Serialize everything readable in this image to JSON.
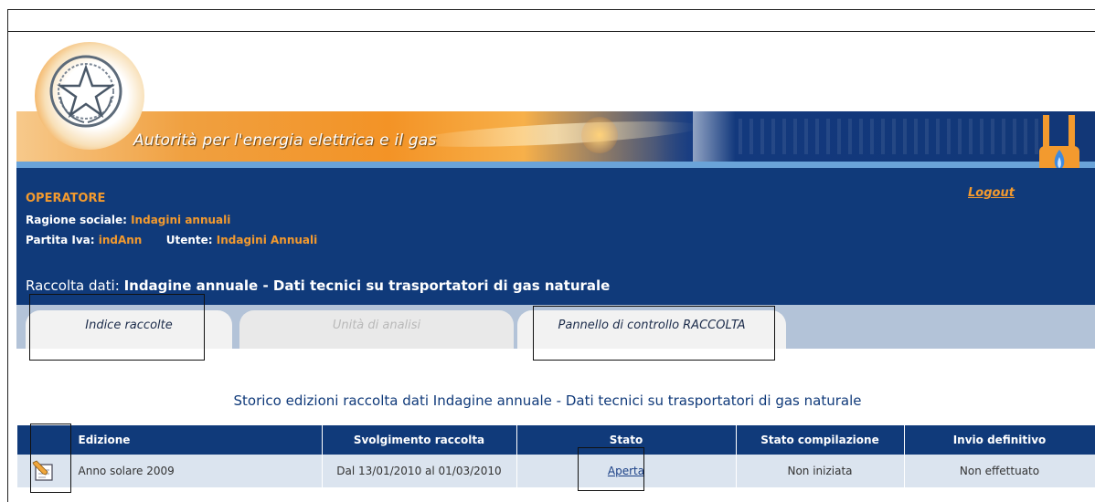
{
  "header": {
    "agency_title": "Autorità per l'energia elettrica e il gas",
    "logout": "Logout"
  },
  "operator": {
    "heading": "OPERATORE",
    "ragione_label": "Ragione sociale:",
    "ragione_value": "Indagini annuali",
    "piva_label": "Partita Iva:",
    "piva_value": "indAnn",
    "utente_label": "Utente:",
    "utente_value": "Indagini Annuali"
  },
  "collection": {
    "label": "Raccolta dati:",
    "title": "Indagine annuale - Dati tecnici su trasportatori di gas naturale"
  },
  "tabs": [
    {
      "label": "Indice raccolte",
      "state": "normal"
    },
    {
      "label": "Unità di analisi",
      "state": "disabled"
    },
    {
      "label": "Pannello di controllo RACCOLTA",
      "state": "normal"
    }
  ],
  "history": {
    "heading": "Storico edizioni raccolta dati Indagine annuale - Dati tecnici su trasportatori di gas naturale",
    "columns": [
      "Edizione",
      "Svolgimento raccolta",
      "Stato",
      "Stato compilazione",
      "Invio definitivo"
    ],
    "rows": [
      {
        "icon": "edit-icon",
        "edizione": "Anno solare 2009",
        "svolgimento": "Dal 13/01/2010 al 01/03/2010",
        "stato": "Aperta",
        "stato_compilazione": "Non iniziata",
        "invio": "Non effettuato"
      }
    ]
  },
  "colors": {
    "navy": "#103a7a",
    "orange": "#f39a2e",
    "tab_bar": "#b3c3d8",
    "row_bg": "#dbe4ef"
  }
}
